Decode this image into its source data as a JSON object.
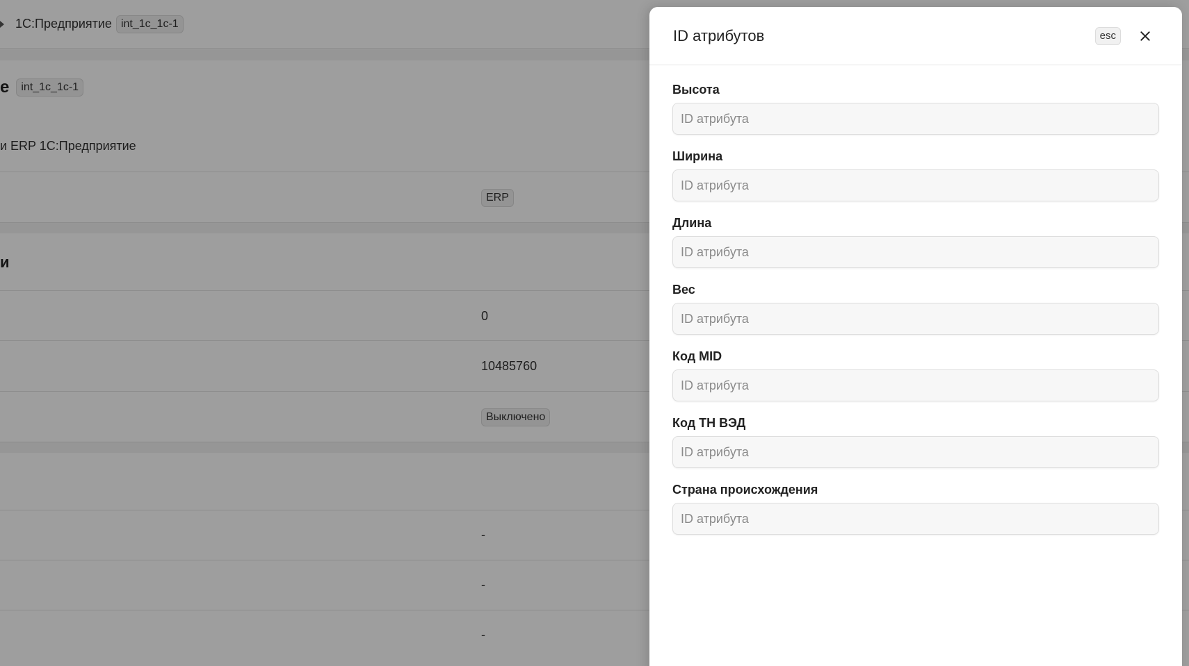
{
  "background": {
    "breadcrumb": {
      "name": "1С:Предприятие",
      "id_chip": "int_1c_1c-1"
    },
    "header": {
      "title_fragment": "е",
      "id_chip": "int_1c_1c-1"
    },
    "description_fragment": "и ERP 1С:Предприятие",
    "type_chip": "ERP",
    "section_fragment": "и",
    "rows": [
      {
        "value": "0"
      },
      {
        "value": "10485760"
      },
      {
        "chip": "Выключено"
      },
      {
        "value": "-"
      },
      {
        "value": "-"
      },
      {
        "value": "-"
      }
    ]
  },
  "drawer": {
    "title": "ID атрибутов",
    "esc_label": "esc",
    "fields": [
      {
        "label": "Высота",
        "value": "",
        "placeholder": "ID атрибута"
      },
      {
        "label": "Ширина",
        "value": "",
        "placeholder": "ID атрибута"
      },
      {
        "label": "Длина",
        "value": "",
        "placeholder": "ID атрибута"
      },
      {
        "label": "Вес",
        "value": "",
        "placeholder": "ID атрибута"
      },
      {
        "label": "Код MID",
        "value": "",
        "placeholder": "ID атрибута"
      },
      {
        "label": "Код ТН ВЭД",
        "value": "",
        "placeholder": "ID атрибута"
      },
      {
        "label": "Страна происхождения",
        "value": "",
        "placeholder": "ID атрибута"
      }
    ]
  }
}
